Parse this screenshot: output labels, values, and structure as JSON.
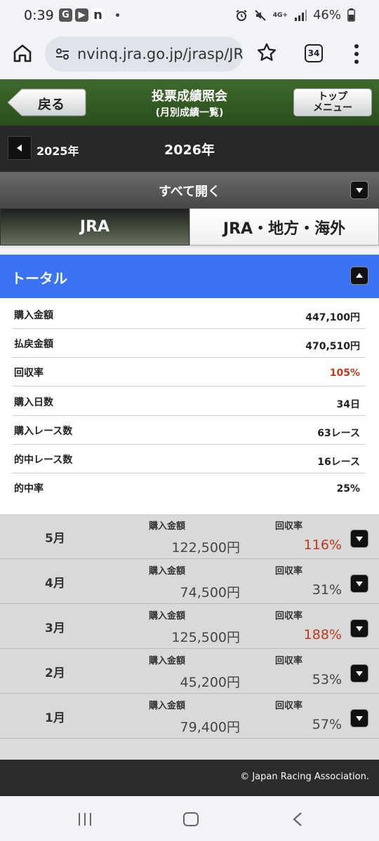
{
  "statusbar": {
    "time": "0:39",
    "app_icons": [
      "G",
      "▶",
      "n"
    ],
    "network": "4G+",
    "battery": "46%"
  },
  "browser": {
    "url": "nvinq.jra.go.jp/jrasp/JR",
    "tab_count": "34"
  },
  "header": {
    "back_label": "戻る",
    "title": "投票成績照会",
    "subtitle": "(月別成績一覧)",
    "top_menu_line1": "トップ",
    "top_menu_line2": "メニュー"
  },
  "year_nav": {
    "prev_year": "2025年",
    "current_year": "2026年"
  },
  "expand_all": "すべて開く",
  "tabs": [
    {
      "label": "JRA",
      "active": true
    },
    {
      "label": "JRA・地方・海外",
      "active": false
    }
  ],
  "total": {
    "title": "トータル",
    "rows": [
      {
        "label": "購入金額",
        "value": "447,100円"
      },
      {
        "label": "払戻金額",
        "value": "470,510円"
      },
      {
        "label": "回収率",
        "value": "105%",
        "highlight": true
      },
      {
        "label": "購入日数",
        "value": "34日"
      },
      {
        "label": "購入レース数",
        "value": "63レース"
      },
      {
        "label": "的中レース数",
        "value": "16レース"
      },
      {
        "label": "的中率",
        "value": "25%"
      }
    ]
  },
  "months": [
    {
      "month": "5月",
      "amount_label": "購入金額",
      "amount": "122,500円",
      "rate_label": "回収率",
      "rate": "116%",
      "highlight": true
    },
    {
      "month": "4月",
      "amount_label": "購入金額",
      "amount": "74,500円",
      "rate_label": "回収率",
      "rate": "31%",
      "highlight": false
    },
    {
      "month": "3月",
      "amount_label": "購入金額",
      "amount": "125,500円",
      "rate_label": "回収率",
      "rate": "188%",
      "highlight": true
    },
    {
      "month": "2月",
      "amount_label": "購入金額",
      "amount": "45,200円",
      "rate_label": "回収率",
      "rate": "53%",
      "highlight": false
    },
    {
      "month": "1月",
      "amount_label": "購入金額",
      "amount": "79,400円",
      "rate_label": "回収率",
      "rate": "57%",
      "highlight": false
    }
  ],
  "footer": {
    "copyright": "© Japan Racing Association."
  },
  "colors": {
    "header_green": "#2f5a20",
    "total_blue": "#3a73f5",
    "highlight_red": "#c0391b"
  }
}
